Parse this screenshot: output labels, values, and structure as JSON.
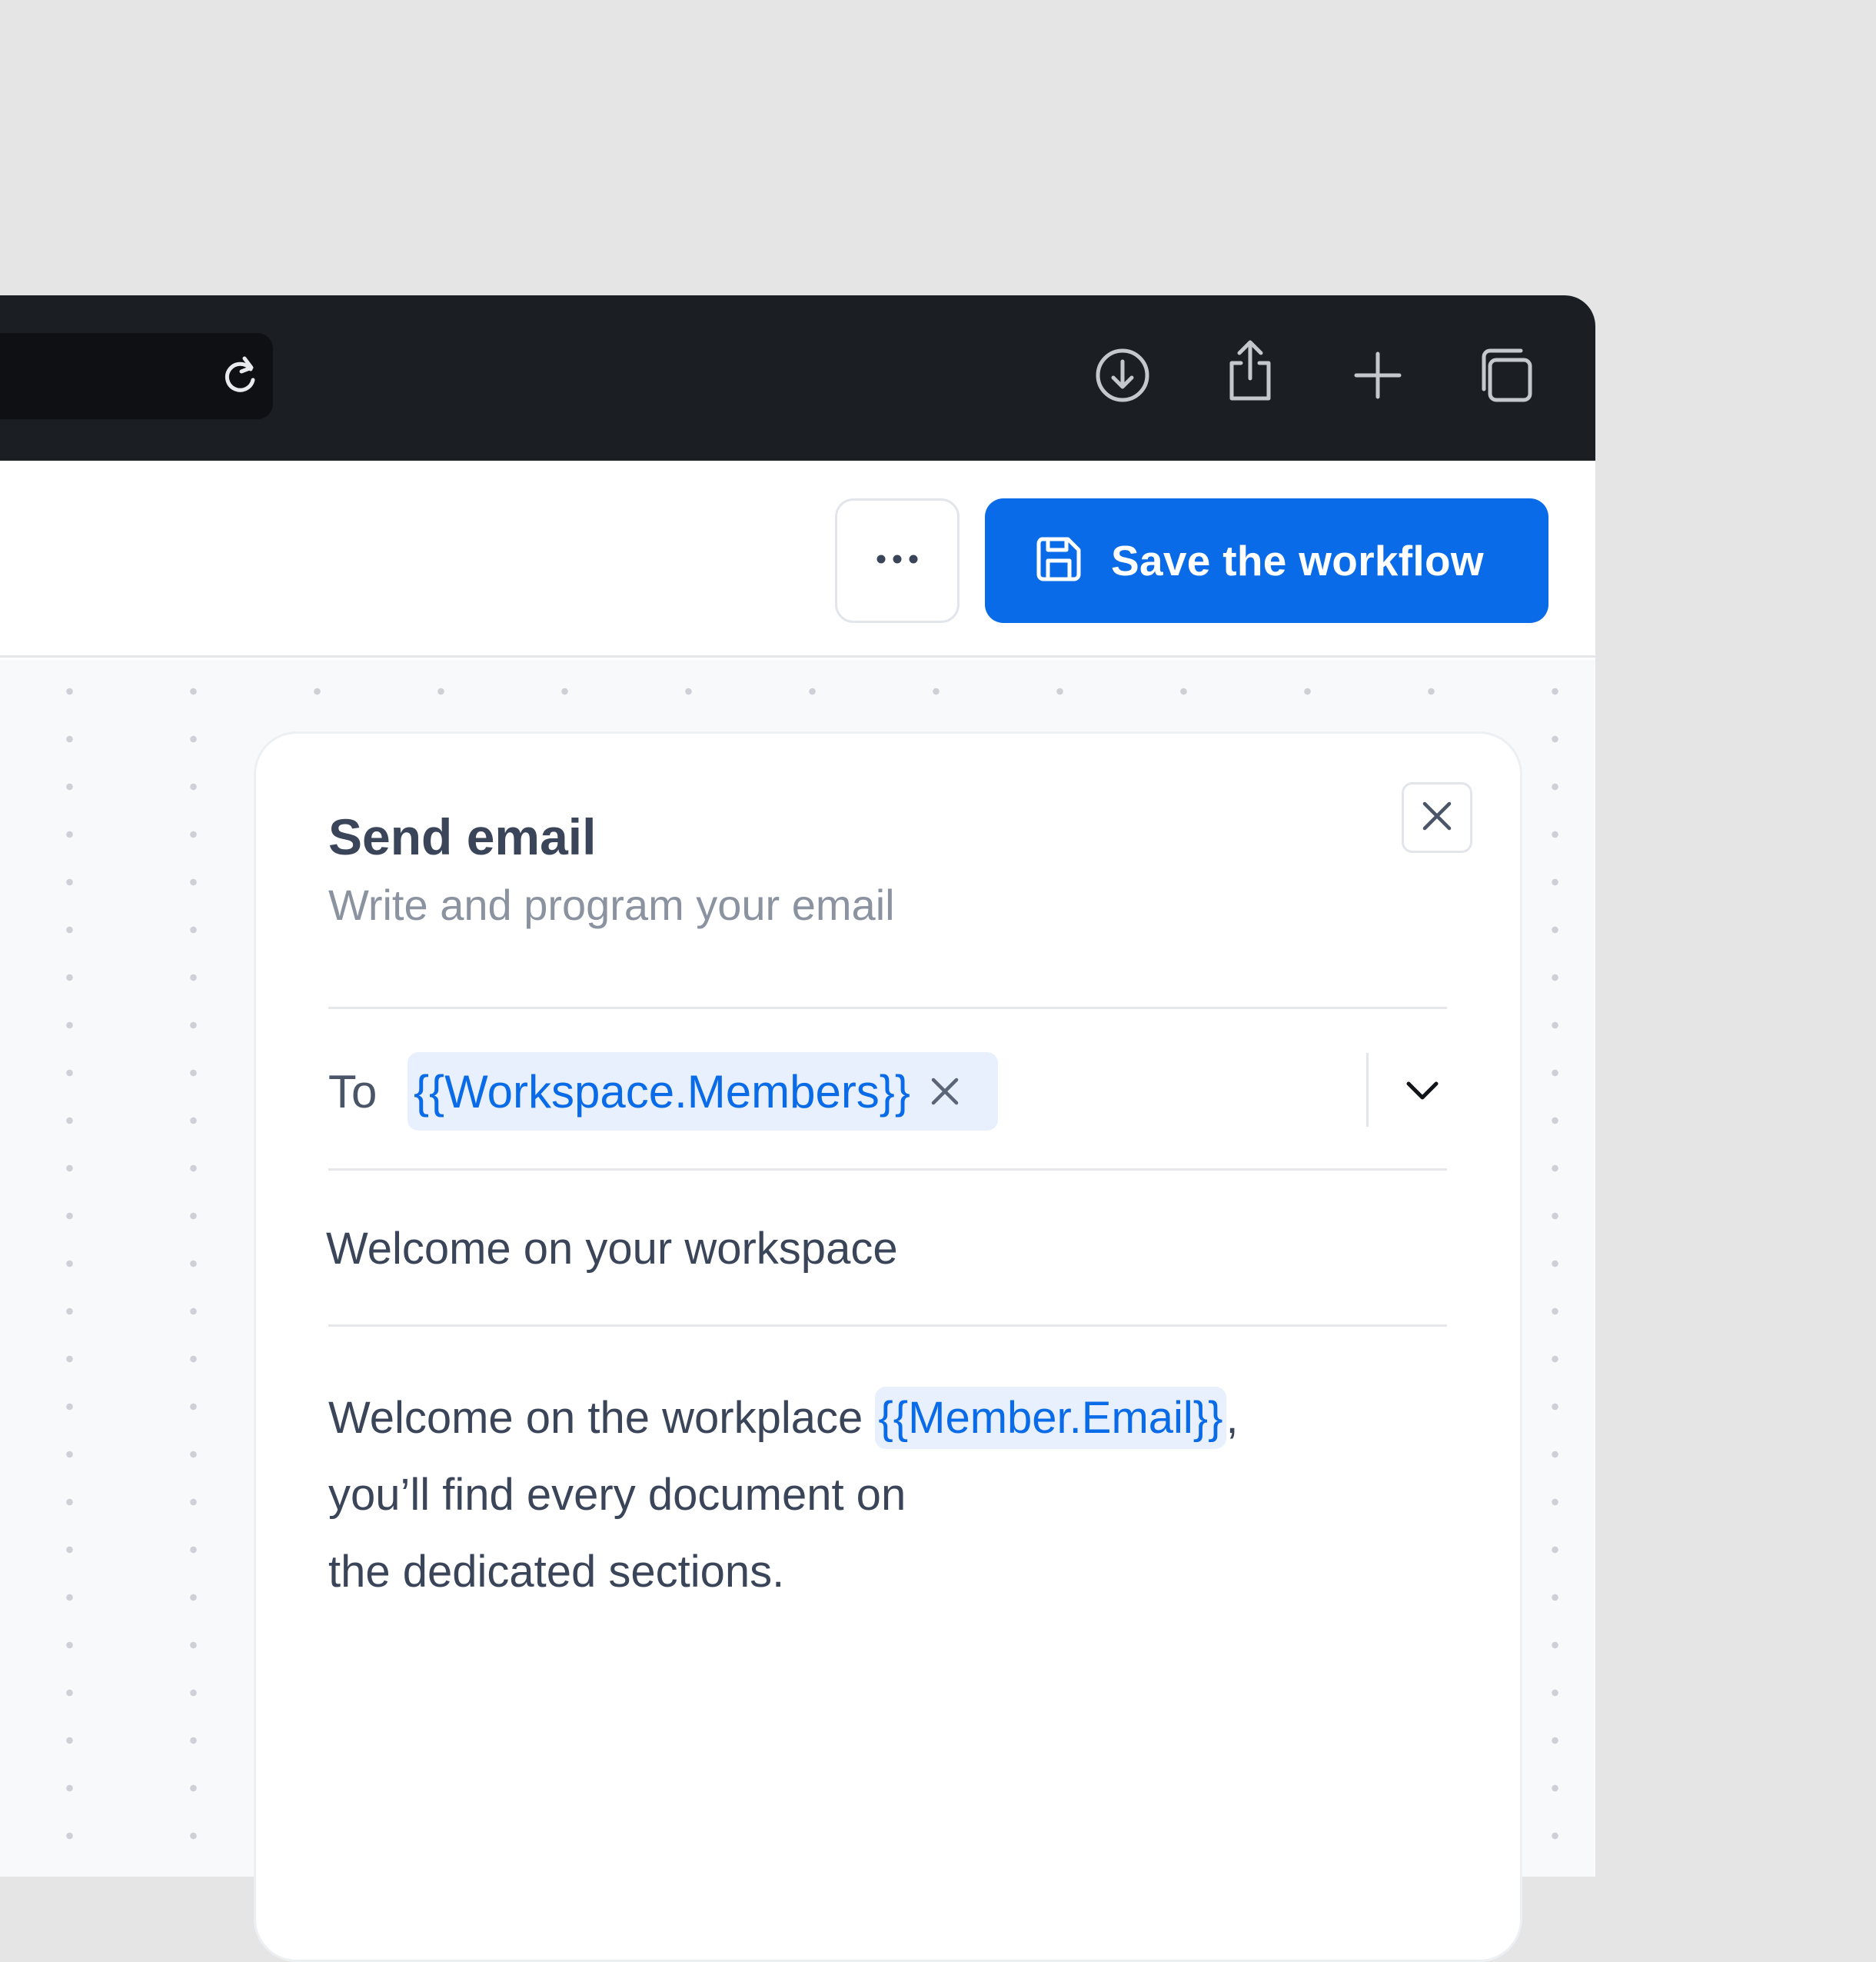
{
  "toolbar": {
    "more_label": "•••",
    "save_label": "Save the workflow"
  },
  "panel": {
    "title": "Send email",
    "subtitle": "Write and program your email",
    "to_label": "To",
    "recipient_chip": "{{Workspace.Members}}",
    "subject": "Welcome on your workspace",
    "body": {
      "line1_text": "Welcome on the workplace ",
      "line1_variable": "{{Member.Email}}",
      "line1_suffix": ",",
      "line2": "you’ll find every document on",
      "line3": "the dedicated sections."
    }
  },
  "icons": {
    "reload": "reload-icon",
    "download": "download-icon",
    "share": "share-icon",
    "new_tab": "plus-icon",
    "tabs": "tabs-icon",
    "save": "floppy-disk-icon",
    "more": "more-dots-icon",
    "close": "close-icon",
    "chip_remove": "close-icon",
    "dropdown": "chevron-down-icon"
  },
  "colors": {
    "accent": "#0a6be8",
    "chrome_bg": "#1b1f23",
    "chip_bg": "#e8f0fd",
    "text_primary": "#3b4559",
    "text_muted": "#8b93a1"
  }
}
